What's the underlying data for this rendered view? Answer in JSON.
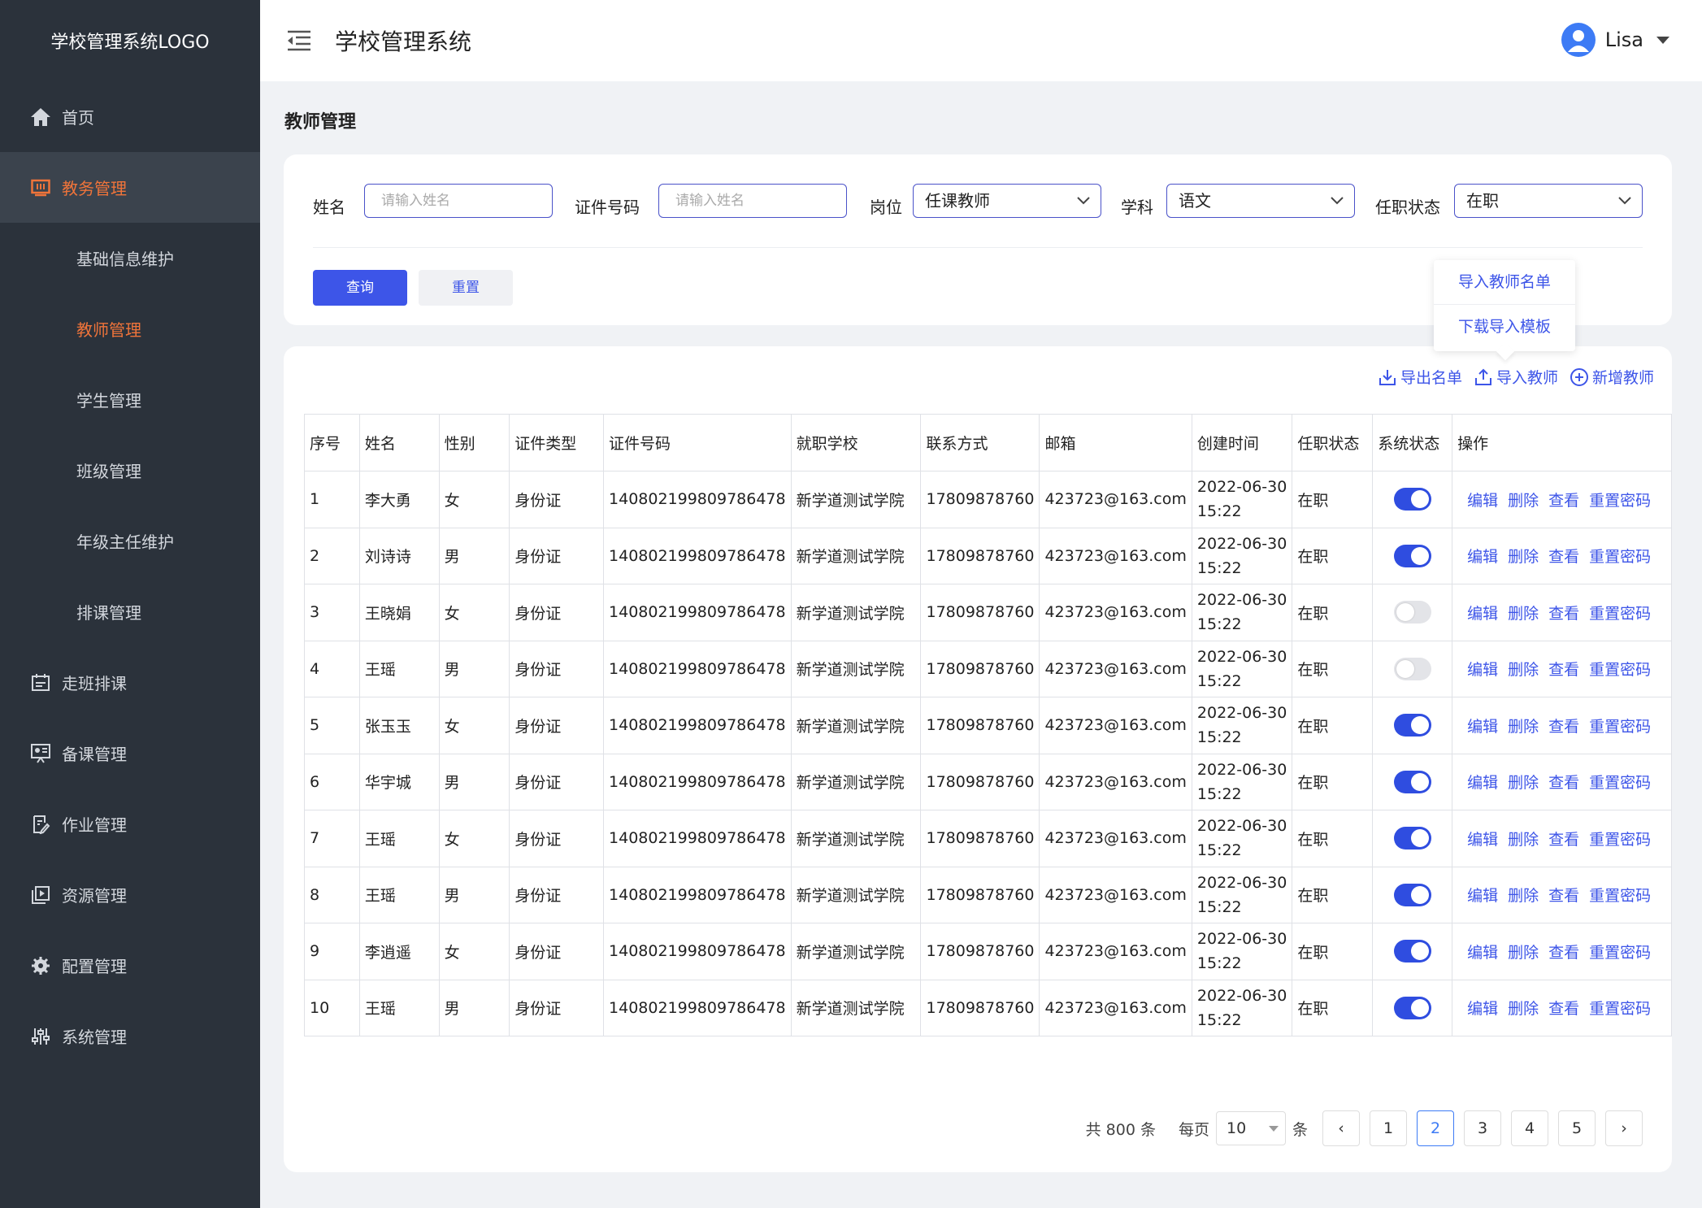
{
  "sidebar": {
    "logo": "学校管理系统LOGO",
    "home": "首页",
    "academic": "教务管理",
    "sub": [
      "基础信息维护",
      "教师管理",
      "学生管理",
      "班级管理",
      "年级主任维护",
      "排课管理"
    ],
    "items": [
      "走班排课",
      "备课管理",
      "作业管理",
      "资源管理",
      "配置管理",
      "系统管理"
    ]
  },
  "header": {
    "title": "学校管理系统",
    "user": "Lisa"
  },
  "page": {
    "title": "教师管理"
  },
  "filters": {
    "name_label": "姓名",
    "name_placeholder": "请输入姓名",
    "id_label": "证件号码",
    "id_placeholder": "请输入姓名",
    "post_label": "岗位",
    "post_value": "任课教师",
    "subject_label": "学科",
    "subject_value": "语文",
    "status_label": "任职状态",
    "status_value": "在职",
    "query": "查询",
    "reset": "重置"
  },
  "dropdown": [
    "导入教师名单",
    "下载导入模板"
  ],
  "toolbar": {
    "export": "导出名单",
    "import": "导入教师",
    "add": "新增教师"
  },
  "table": {
    "headers": [
      "序号",
      "姓名",
      "性别",
      "证件类型",
      "证件号码",
      "就职学校",
      "联系方式",
      "邮箱",
      "创建时间",
      "任职状态",
      "系统状态",
      "操作"
    ],
    "ops": [
      "编辑",
      "删除",
      "查看",
      "重置密码"
    ],
    "rows": [
      {
        "no": "1",
        "name": "李大勇",
        "sex": "女",
        "idtype": "身份证",
        "idno": "140802199809786478",
        "school": "新学道测试学院",
        "phone": "17809878760",
        "email": "423723@163.com",
        "date": "2022-06-30",
        "time": "15:22",
        "status": "在职",
        "on": true
      },
      {
        "no": "2",
        "name": "刘诗诗",
        "sex": "男",
        "idtype": "身份证",
        "idno": "140802199809786478",
        "school": "新学道测试学院",
        "phone": "17809878760",
        "email": "423723@163.com",
        "date": "2022-06-30",
        "time": "15:22",
        "status": "在职",
        "on": true
      },
      {
        "no": "3",
        "name": "王晓娟",
        "sex": "女",
        "idtype": "身份证",
        "idno": "140802199809786478",
        "school": "新学道测试学院",
        "phone": "17809878760",
        "email": "423723@163.com",
        "date": "2022-06-30",
        "time": "15:22",
        "status": "在职",
        "on": false
      },
      {
        "no": "4",
        "name": "王瑶",
        "sex": "男",
        "idtype": "身份证",
        "idno": "140802199809786478",
        "school": "新学道测试学院",
        "phone": "17809878760",
        "email": "423723@163.com",
        "date": "2022-06-30",
        "time": "15:22",
        "status": "在职",
        "on": false
      },
      {
        "no": "5",
        "name": "张玉玉",
        "sex": "女",
        "idtype": "身份证",
        "idno": "140802199809786478",
        "school": "新学道测试学院",
        "phone": "17809878760",
        "email": "423723@163.com",
        "date": "2022-06-30",
        "time": "15:22",
        "status": "在职",
        "on": true
      },
      {
        "no": "6",
        "name": "华宇城",
        "sex": "男",
        "idtype": "身份证",
        "idno": "140802199809786478",
        "school": "新学道测试学院",
        "phone": "17809878760",
        "email": "423723@163.com",
        "date": "2022-06-30",
        "time": "15:22",
        "status": "在职",
        "on": true
      },
      {
        "no": "7",
        "name": "王瑶",
        "sex": "女",
        "idtype": "身份证",
        "idno": "140802199809786478",
        "school": "新学道测试学院",
        "phone": "17809878760",
        "email": "423723@163.com",
        "date": "2022-06-30",
        "time": "15:22",
        "status": "在职",
        "on": true
      },
      {
        "no": "8",
        "name": "王瑶",
        "sex": "男",
        "idtype": "身份证",
        "idno": "140802199809786478",
        "school": "新学道测试学院",
        "phone": "17809878760",
        "email": "423723@163.com",
        "date": "2022-06-30",
        "time": "15:22",
        "status": "在职",
        "on": true
      },
      {
        "no": "9",
        "name": "李逍遥",
        "sex": "女",
        "idtype": "身份证",
        "idno": "140802199809786478",
        "school": "新学道测试学院",
        "phone": "17809878760",
        "email": "423723@163.com",
        "date": "2022-06-30",
        "time": "15:22",
        "status": "在职",
        "on": true
      },
      {
        "no": "10",
        "name": "王瑶",
        "sex": "男",
        "idtype": "身份证",
        "idno": "140802199809786478",
        "school": "新学道测试学院",
        "phone": "17809878760",
        "email": "423723@163.com",
        "date": "2022-06-30",
        "time": "15:22",
        "status": "在职",
        "on": true
      }
    ]
  },
  "pagination": {
    "total": "共 800 条",
    "per_page_label": "每页",
    "per_page": "10",
    "unit": "条",
    "pages": [
      "1",
      "2",
      "3",
      "4",
      "5"
    ],
    "current": "2",
    "prev": "‹",
    "next": "›"
  },
  "colors": {
    "accent": "#3d55e8",
    "sidebar_bg": "#2b323b",
    "active_nav": "#f0743a",
    "switch_on": "#2f4de0"
  },
  "icons": [
    "home-icon",
    "academic-icon",
    "schedule-icon",
    "prep-icon",
    "homework-icon",
    "resource-icon",
    "gear-icon",
    "system-icon",
    "menu-fold-icon",
    "user-avatar-icon",
    "export-icon",
    "import-icon",
    "add-circle-icon"
  ]
}
